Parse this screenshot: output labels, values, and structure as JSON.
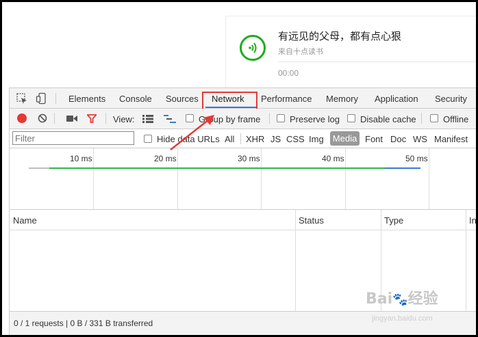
{
  "audio_card": {
    "title": "有远见的父母，都有点心狠",
    "source": "来自十点读书",
    "time": "00:00"
  },
  "devtools": {
    "tabs": [
      "Elements",
      "Console",
      "Sources",
      "Network",
      "Performance",
      "Memory",
      "Application",
      "Security"
    ],
    "active_tab": "Network",
    "toolbar": {
      "view_label": "View:",
      "group_by_frame": "Group by frame",
      "preserve_log": "Preserve log",
      "disable_cache": "Disable cache",
      "offline": "Offline"
    },
    "filter": {
      "placeholder": "Filter",
      "hide_data_urls": "Hide data URLs",
      "types": [
        "All",
        "XHR",
        "JS",
        "CSS",
        "Img",
        "Media",
        "Font",
        "Doc",
        "WS",
        "Manifest"
      ],
      "selected_type": "Media"
    },
    "timeline": {
      "ticks": [
        "10 ms",
        "20 ms",
        "30 ms",
        "40 ms",
        "50 ms"
      ]
    },
    "table": {
      "columns": [
        "Name",
        "Status",
        "Type",
        "In"
      ]
    },
    "status_bar": "0 / 1 requests  |  0 B / 331 B transferred"
  },
  "colors": {
    "record": "#e53935",
    "highlight_box": "#e53935",
    "active_underline": "#3879d9",
    "play_green": "#1aad19",
    "timeline_green": "#2fb84a",
    "timeline_blue": "#3879d9"
  },
  "watermark": {
    "logo_text": "Bai 经验",
    "url": "jingyan.baidu.com"
  }
}
